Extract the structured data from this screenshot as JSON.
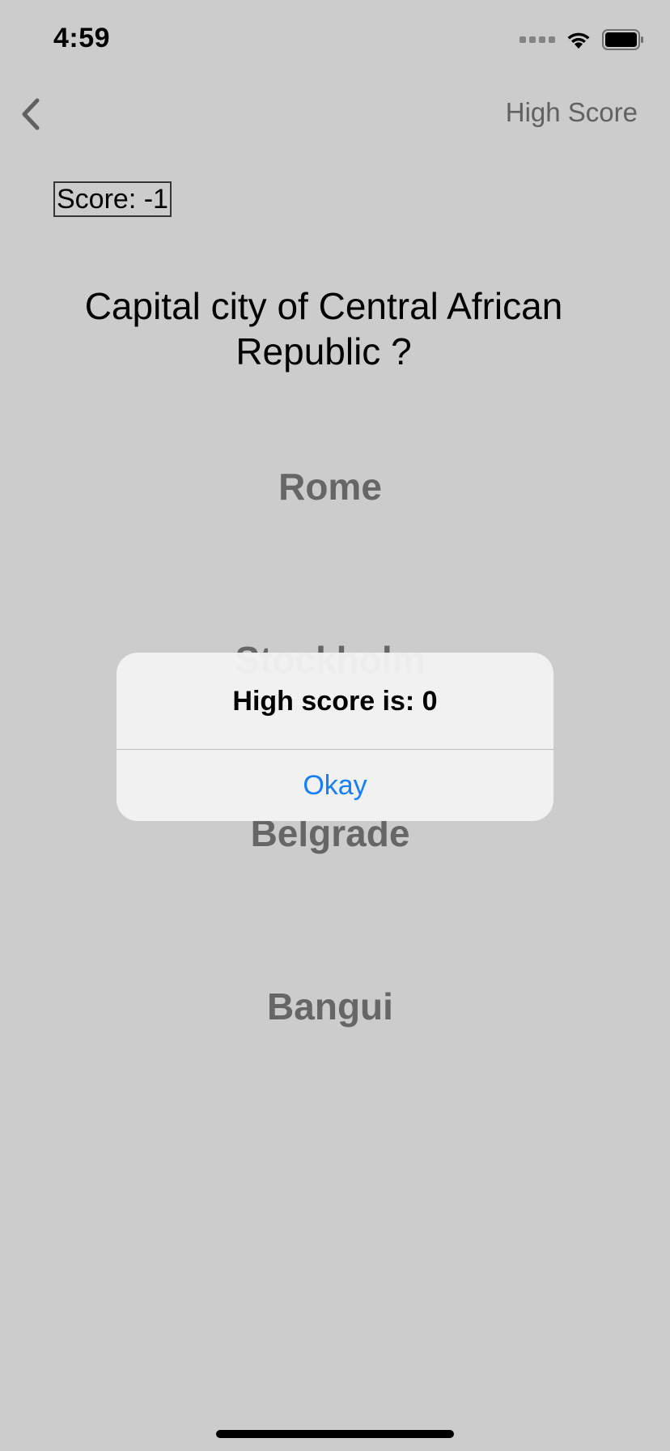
{
  "status_bar": {
    "time": "4:59"
  },
  "nav": {
    "right_label": "High Score"
  },
  "game": {
    "score_label": "Score: -1",
    "question": "Capital city of Central African Republic ?",
    "answers": [
      "Rome",
      "Stockholm",
      "Belgrade",
      "Bangui"
    ]
  },
  "alert": {
    "title": "High score is: 0",
    "button_label": "Okay"
  },
  "colors": {
    "accent": "#147efb",
    "answer_text": "#808080",
    "nav_text": "#7a7a7a"
  }
}
